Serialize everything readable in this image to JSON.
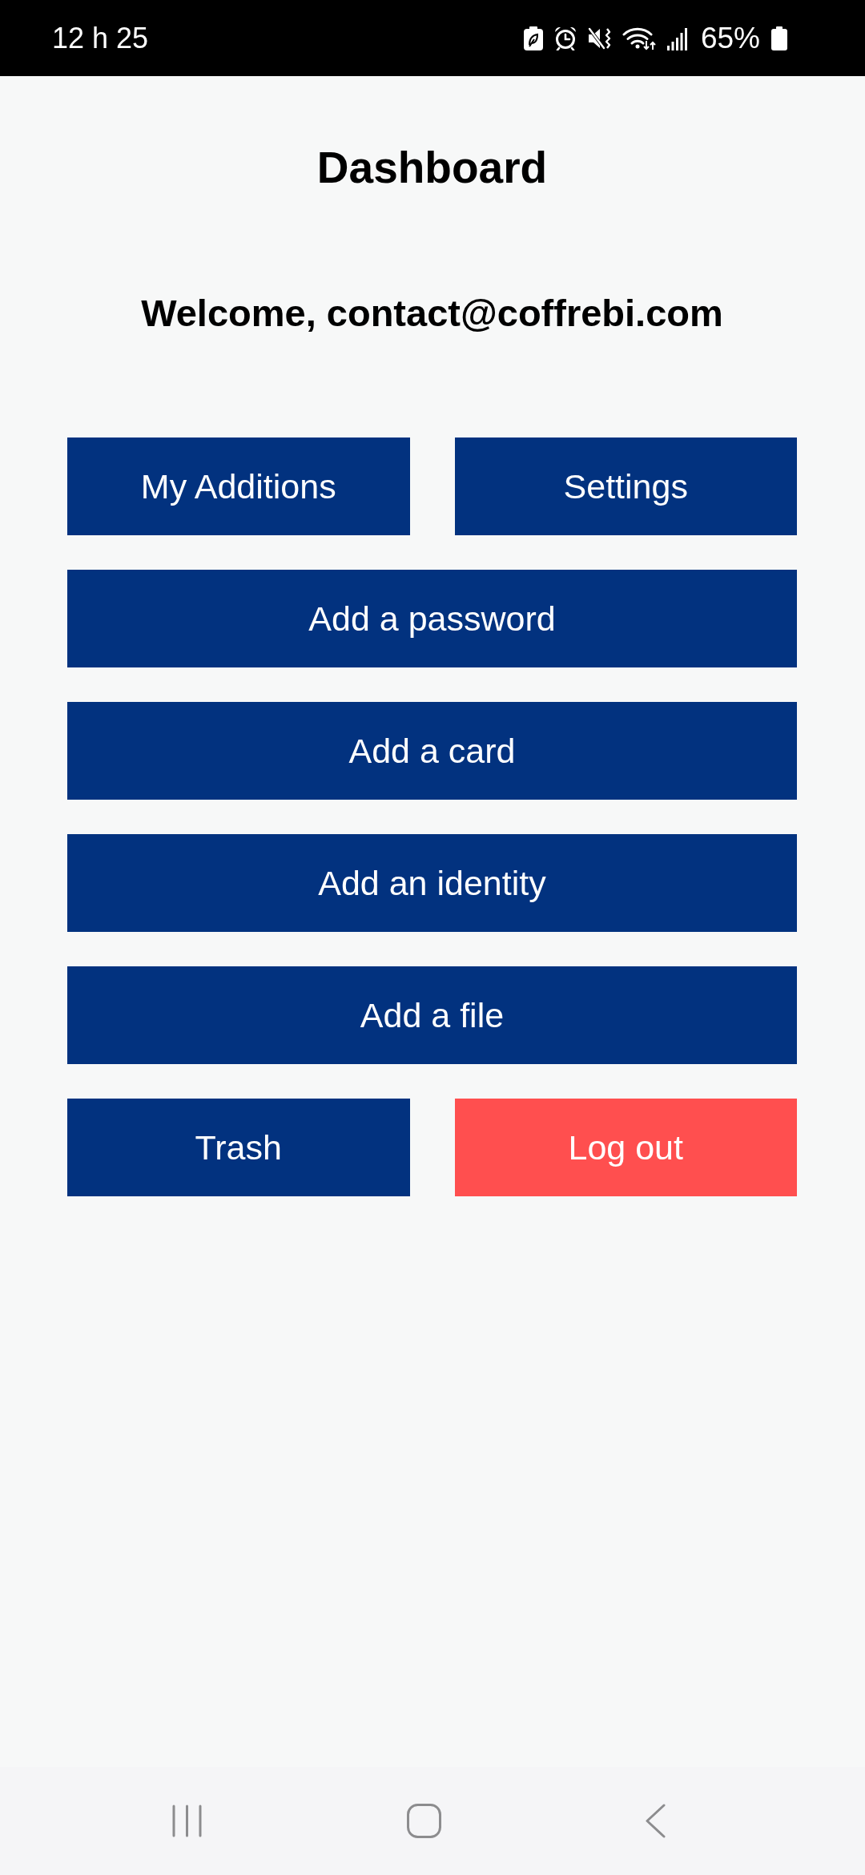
{
  "status_bar": {
    "time": "12 h 25",
    "battery": "65%"
  },
  "header": {
    "title": "Dashboard"
  },
  "welcome": "Welcome, contact@coffrebi.com",
  "action_rows": [
    [
      {
        "label": "My Additions",
        "kind": "primary"
      },
      {
        "label": "Settings",
        "kind": "primary"
      }
    ],
    [
      {
        "label": "Add a password",
        "kind": "primary"
      }
    ],
    [
      {
        "label": "Add a card",
        "kind": "primary"
      }
    ],
    [
      {
        "label": "Add an identity",
        "kind": "primary"
      }
    ],
    [
      {
        "label": "Add a file",
        "kind": "primary"
      }
    ],
    [
      {
        "label": "Trash",
        "kind": "primary"
      },
      {
        "label": "Log out",
        "kind": "danger"
      }
    ]
  ]
}
